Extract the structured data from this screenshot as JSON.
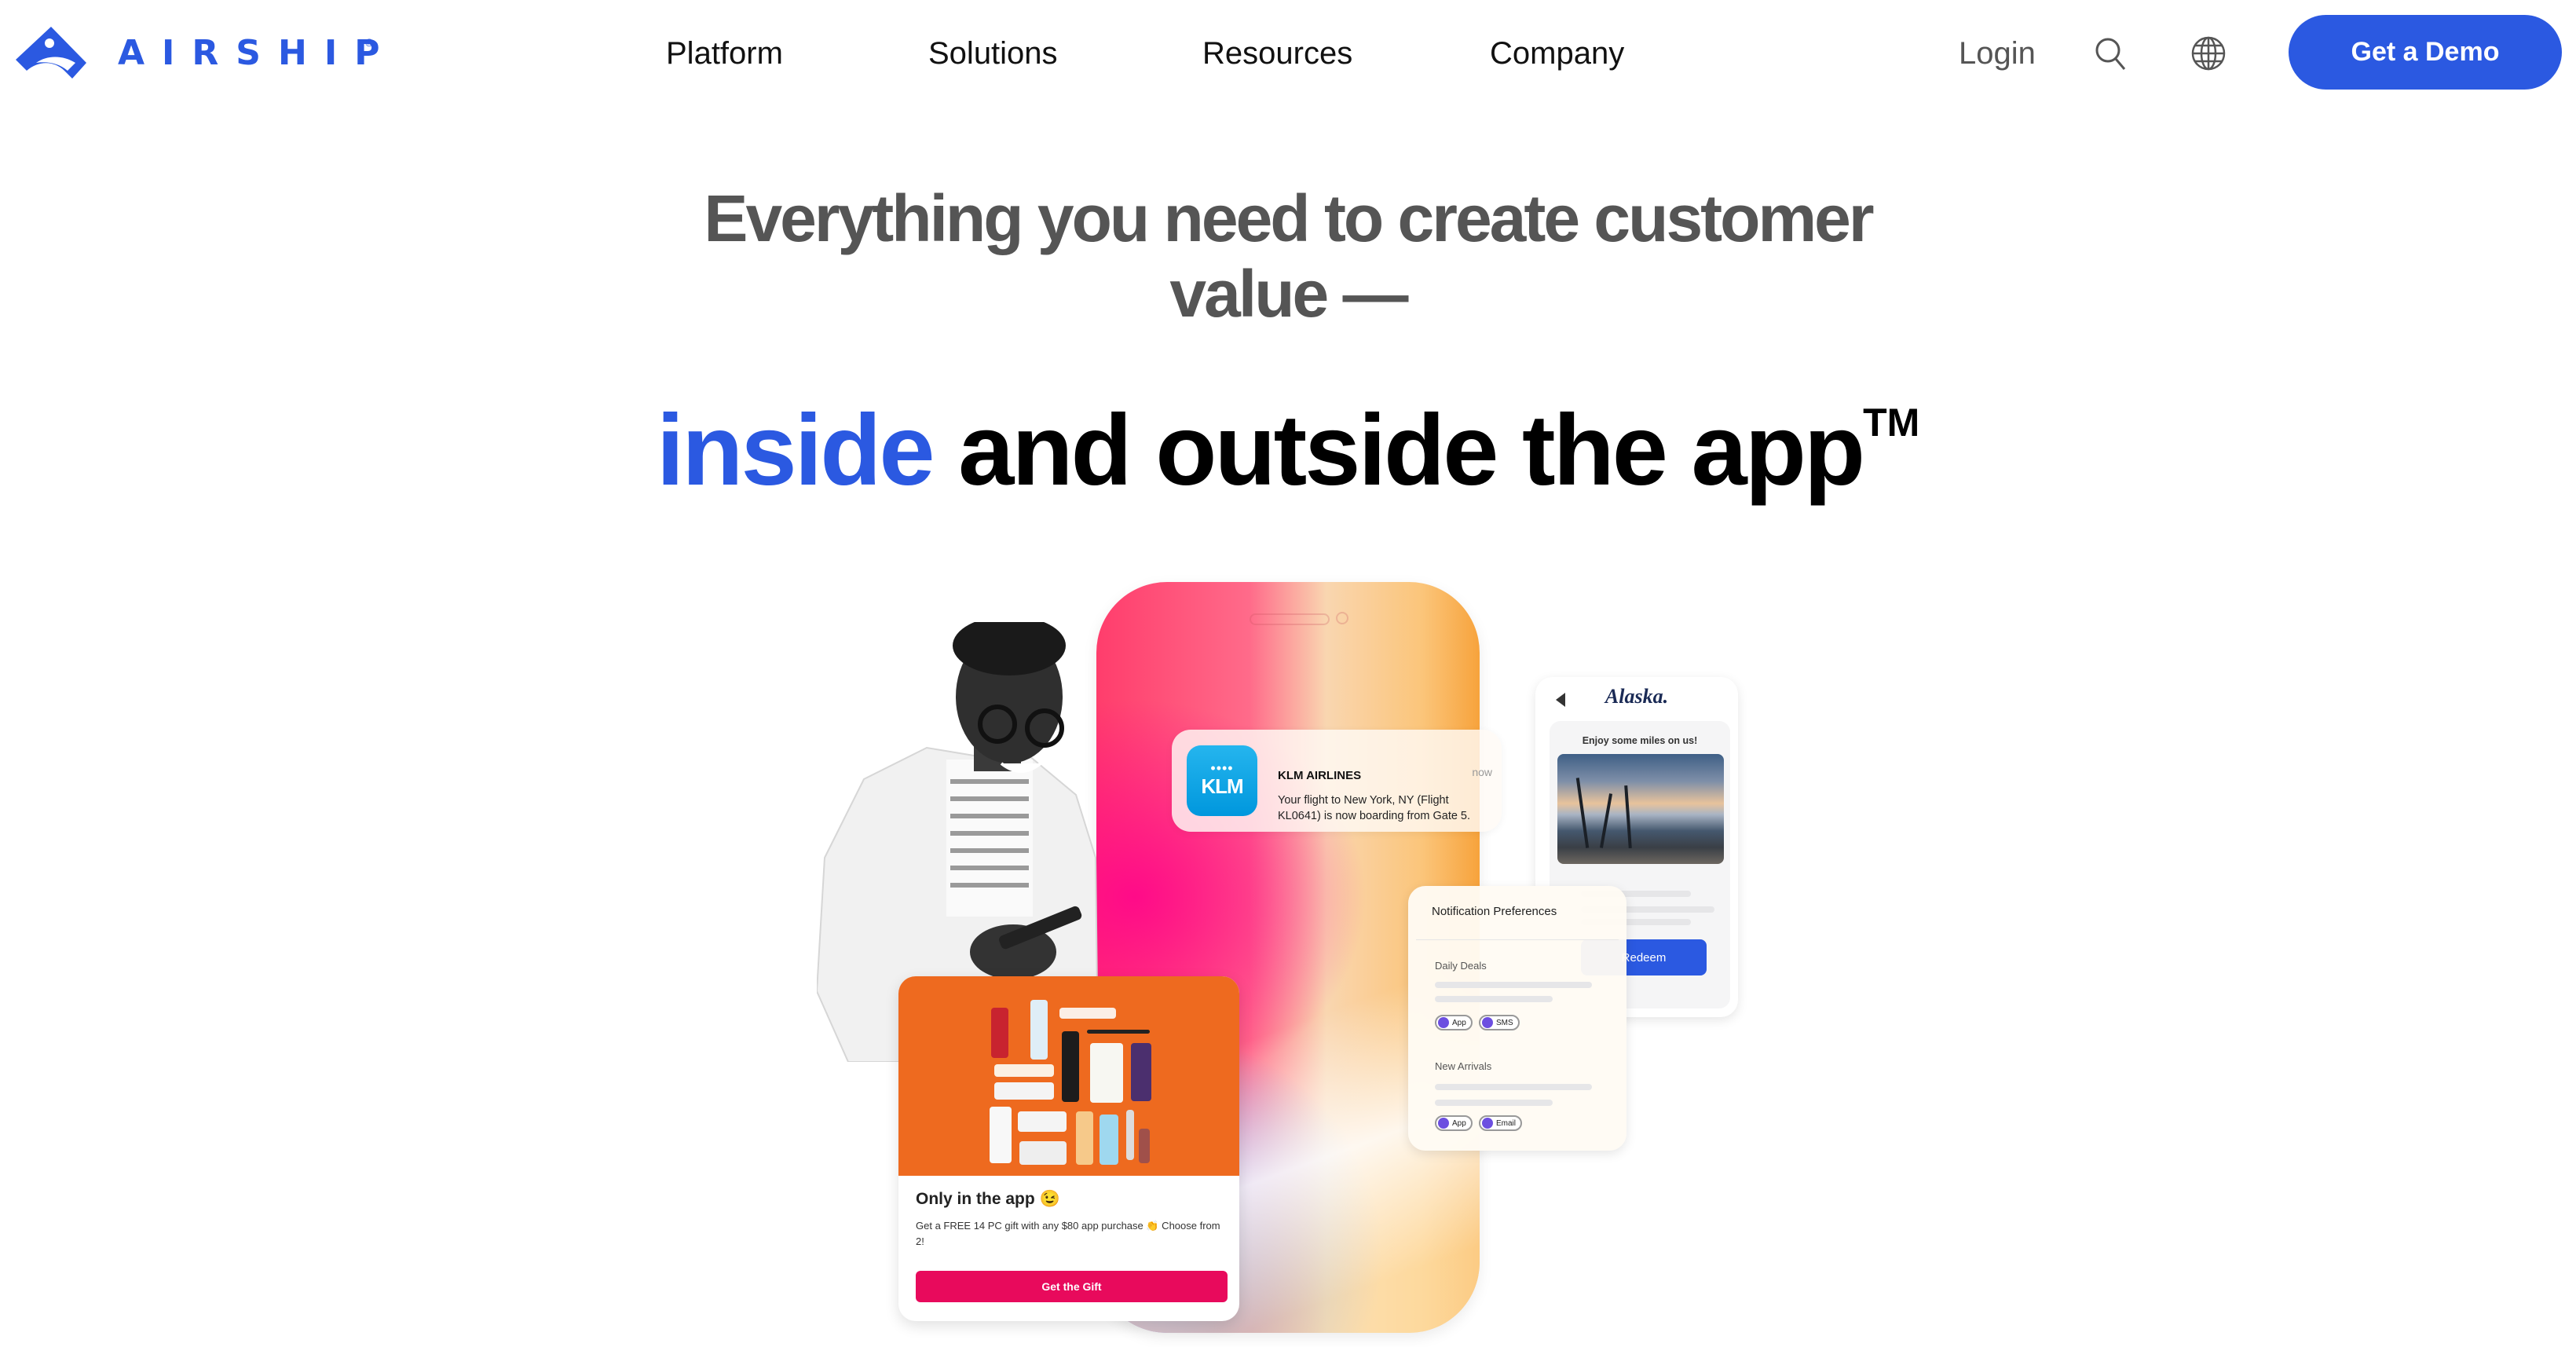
{
  "header": {
    "logo_text": "AIRSHIP",
    "logo_mark": "®",
    "nav": [
      "Platform",
      "Solutions",
      "Resources",
      "Company"
    ],
    "login_label": "Login",
    "search_icon": "search-icon",
    "globe_icon": "globe-icon",
    "cta_label": "Get a Demo"
  },
  "hero": {
    "title_line1": "Everything you need to create customer",
    "title_line2": "value —",
    "sub_accent": "inside",
    "sub_and": " and ",
    "sub_bold": "outside",
    "sub_rest": " the app",
    "sub_tm": "TM"
  },
  "illustration": {
    "klm": {
      "logo_text": "KLM",
      "crown": "••••",
      "sender": "KLM AIRLINES",
      "time": "now",
      "body": "Your flight to New York, NY (Flight KL0641) is now boarding from Gate 5."
    },
    "alaska": {
      "brand": "Alaska.",
      "headline": "Enjoy some miles on us!",
      "button_label": "Redeem"
    },
    "prefs": {
      "title": "Notification Preferences",
      "sections": [
        {
          "label": "Daily Deals",
          "chips": [
            "App",
            "SMS"
          ]
        },
        {
          "label": "New Arrivals",
          "chips": [
            "App",
            "Email"
          ]
        }
      ]
    },
    "gift": {
      "title": "Only in the app 😉",
      "body": "Get a FREE 14 PC gift with any $80 app purchase 👏 Choose from 2!",
      "button_label": "Get the Gift"
    }
  },
  "colors": {
    "brand_blue": "#2b59e1",
    "gift_orange": "#ee6a1f",
    "gift_button": "#e80a5c",
    "chip_dot": "#6c4fe0"
  }
}
